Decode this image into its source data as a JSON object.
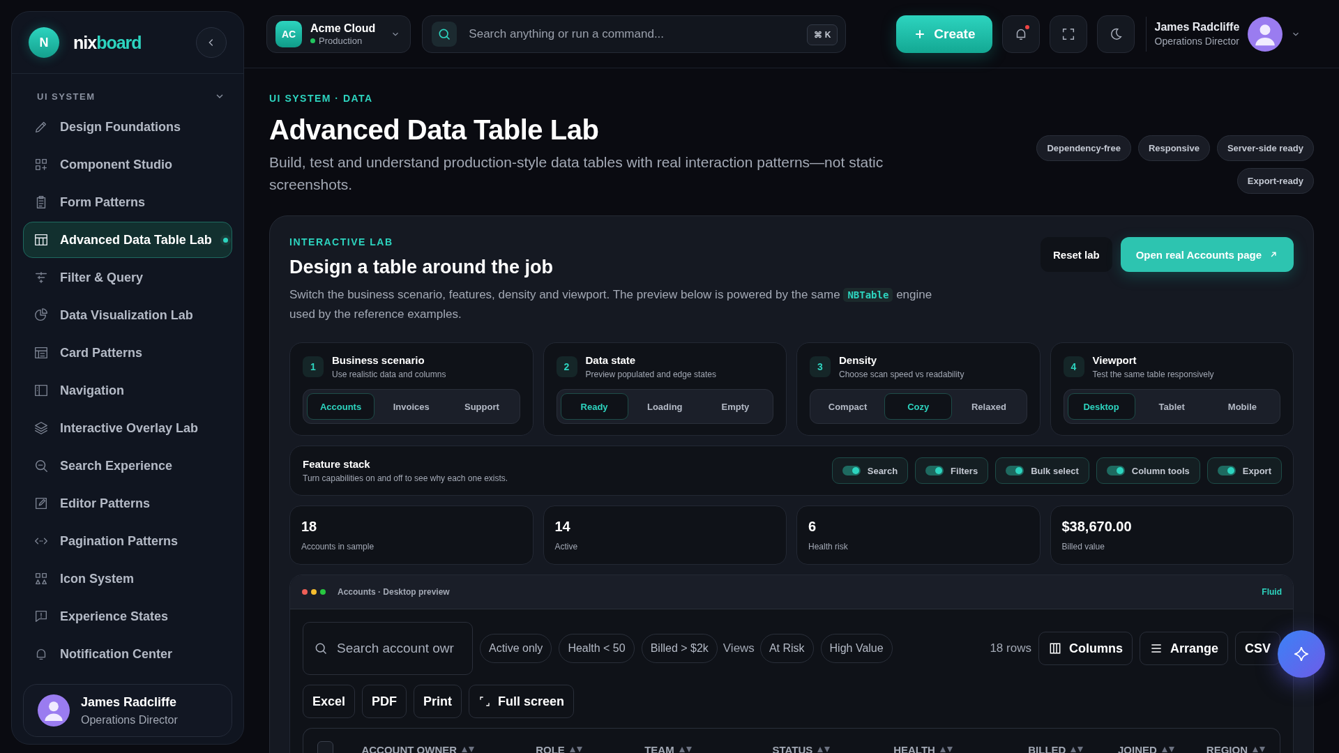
{
  "sidebar": {
    "logo": {
      "initial": "N",
      "name_first": "nix",
      "name_second": "board"
    },
    "section": "UI SYSTEM",
    "items": [
      {
        "label": "Design Foundations",
        "kind": "pencil",
        "selected": false
      },
      {
        "label": "Component Studio",
        "kind": "grid",
        "selected": false
      },
      {
        "label": "Form Patterns",
        "kind": "clipboard",
        "selected": false
      },
      {
        "label": "Advanced Data Table Lab",
        "kind": "table",
        "selected": true
      },
      {
        "label": "Filter & Query",
        "kind": "sliders",
        "selected": false
      },
      {
        "label": "Data Visualization Lab",
        "kind": "pie",
        "selected": false
      },
      {
        "label": "Card Patterns",
        "kind": "card",
        "selected": false
      },
      {
        "label": "Navigation",
        "kind": "panel",
        "selected": false
      },
      {
        "label": "Interactive Overlay Lab",
        "kind": "layers",
        "selected": false
      },
      {
        "label": "Search Experience",
        "kind": "zoom",
        "selected": false
      },
      {
        "label": "Editor Patterns",
        "kind": "edit",
        "selected": false
      },
      {
        "label": "Pagination Patterns",
        "kind": "arrows",
        "selected": false
      },
      {
        "label": "Icon System",
        "kind": "shapes",
        "selected": false
      },
      {
        "label": "Experience States",
        "kind": "alert",
        "selected": false
      },
      {
        "label": "Notification Center",
        "kind": "bell",
        "selected": false
      }
    ],
    "user": {
      "name": "James Radcliffe",
      "role": "Operations Director"
    }
  },
  "header": {
    "workspace": {
      "initials": "AC",
      "name": "Acme Cloud",
      "environment": "Production"
    },
    "search": {
      "placeholder": "Search anything or run a command...",
      "shortcut": "⌘ K"
    },
    "create": "Create",
    "notifications": {
      "unread": true
    },
    "user": {
      "name": "James Radcliffe",
      "role": "Operations Director"
    }
  },
  "page": {
    "breadcrumb": "UI SYSTEM · DATA",
    "title": "Advanced Data Table Lab",
    "description": "Build, test and understand production-style data tables with real interaction patterns—not static screenshots.",
    "tags": [
      "Dependency-free",
      "Responsive",
      "Server-side ready",
      "Export-ready"
    ]
  },
  "lab": {
    "eyebrow": "INTERACTIVE LAB",
    "title": "Design a table around the job",
    "description_before": "Switch the business scenario, features, density and viewport. The preview below is powered by the same",
    "code": "NBTable",
    "description_after": "engine used by the reference examples.",
    "reset": "Reset lab",
    "open": "Open real Accounts page",
    "steps": [
      {
        "number": "1",
        "title": "Business scenario",
        "subtitle": "Use realistic data and columns",
        "options": [
          {
            "label": "Accounts",
            "selected": true
          },
          {
            "label": "Invoices",
            "selected": false
          },
          {
            "label": "Support",
            "selected": false
          }
        ]
      },
      {
        "number": "2",
        "title": "Data state",
        "subtitle": "Preview populated and edge states",
        "options": [
          {
            "label": "Ready",
            "selected": true
          },
          {
            "label": "Loading",
            "selected": false
          },
          {
            "label": "Empty",
            "selected": false
          }
        ]
      },
      {
        "number": "3",
        "title": "Density",
        "subtitle": "Choose scan speed vs readability",
        "options": [
          {
            "label": "Compact",
            "selected": false
          },
          {
            "label": "Cozy",
            "selected": true
          },
          {
            "label": "Relaxed",
            "selected": false
          }
        ]
      },
      {
        "number": "4",
        "title": "Viewport",
        "subtitle": "Test the same table responsively",
        "options": [
          {
            "label": "Desktop",
            "selected": true
          },
          {
            "label": "Tablet",
            "selected": false
          },
          {
            "label": "Mobile",
            "selected": false
          }
        ]
      }
    ],
    "features": {
      "title": "Feature stack",
      "subtitle": "Turn capabilities on and off to see why each one exists.",
      "toggles": [
        {
          "label": "Search",
          "on": true
        },
        {
          "label": "Filters",
          "on": true
        },
        {
          "label": "Bulk select",
          "on": true
        },
        {
          "label": "Column tools",
          "on": true
        },
        {
          "label": "Export",
          "on": true
        }
      ]
    },
    "stats": [
      {
        "value": "18",
        "label": "Accounts in sample"
      },
      {
        "value": "14",
        "label": "Active"
      },
      {
        "value": "6",
        "label": "Health risk"
      },
      {
        "value": "$38,670.00",
        "label": "Billed value"
      }
    ],
    "preview": {
      "title": "Accounts · Desktop preview",
      "mode": "Fluid",
      "search_placeholder": "Search account owr",
      "filters": [
        "Active only",
        "Health < 50",
        "Billed > $2k"
      ],
      "views_label": "Views",
      "views": [
        "At Risk",
        "High Value"
      ],
      "row_count": "18 rows",
      "tools": [
        {
          "label": "Columns",
          "kind": "columns"
        },
        {
          "label": "Arrange",
          "kind": "lines"
        },
        {
          "label": "CSV",
          "kind": "none"
        }
      ],
      "exports": [
        {
          "label": "Excel",
          "kind": "none"
        },
        {
          "label": "PDF",
          "kind": "none"
        },
        {
          "label": "Print",
          "kind": "none"
        },
        {
          "label": "Full screen",
          "kind": "expand"
        }
      ],
      "select_all": {
        "checked": false
      },
      "columns": [
        "ACCOUNT OWNER",
        "ROLE",
        "TEAM",
        "STATUS",
        "HEALTH",
        "BILLED",
        "JOINED",
        "REGION"
      ]
    }
  }
}
